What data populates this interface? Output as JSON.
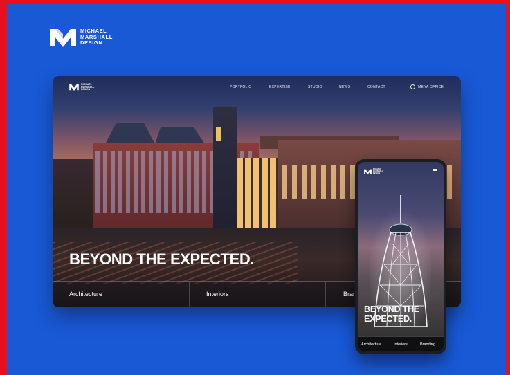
{
  "brand": {
    "lines": [
      "MICHAEL",
      "MARSHALL",
      "DESIGN"
    ],
    "icon": "mm-monogram-logo"
  },
  "desktop": {
    "logo_lines": [
      "MICHAEL",
      "MARSHALL",
      "DESIGN"
    ],
    "nav": [
      "PORTFOLIO",
      "EXPERTISE",
      "STUDIO",
      "NEWS",
      "CONTACT"
    ],
    "office_label": "MENA OFFICE",
    "office_icon": "globe-ring-icon",
    "headline": "BEYOND THE EXPECTED.",
    "categories": [
      "Architecture",
      "Interiors",
      "Brand"
    ]
  },
  "mobile": {
    "logo_lines": [
      "MICHAEL",
      "MARSHALL",
      "DESIGN"
    ],
    "menu_icon": "hamburger-menu-icon",
    "headline_line1": "BEYOND THE",
    "headline_line2": "EXPECTED.",
    "categories": [
      "Architecture",
      "Interiors",
      "Branding"
    ]
  },
  "colors": {
    "background": "#1959d6",
    "border": "#e8101a"
  }
}
